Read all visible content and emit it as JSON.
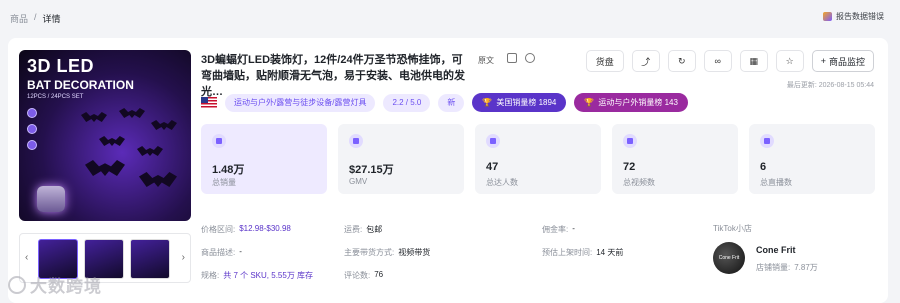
{
  "breadcrumb": {
    "parent": "商品",
    "sep": "/",
    "current": "详情"
  },
  "report_label": "报告数据错误",
  "product": {
    "title": "3D蝙蝠灯LED装饰灯，12件/24件万圣节恐怖挂饰，可弯曲墙贴，贴附顺滑无气泡，易于安装、电池供电的发光…",
    "original_label": "原文",
    "updated": "最后更新: 2026-08-15 05:44"
  },
  "hero_image": {
    "line1": "3D LED",
    "line2": "BAT DECORATION",
    "line3": "12PCS / 24PCS SET"
  },
  "actions": {
    "shelf": "货盘",
    "monitor": "商品监控"
  },
  "tags": {
    "category": "运动与户外/露营与徒步设备/露营灯具",
    "rating": "2.2 / 5.0",
    "new": "新",
    "us_rank": "美国销量榜 1894",
    "cat_rank": "运动与户外销量榜 143"
  },
  "stats": [
    {
      "value": "1.48万",
      "label": "总销量"
    },
    {
      "value": "$27.15万",
      "label": "GMV"
    },
    {
      "value": "47",
      "label": "总达人数"
    },
    {
      "value": "72",
      "label": "总视频数"
    },
    {
      "value": "6",
      "label": "总直播数"
    }
  ],
  "info": {
    "price_label": "价格区间:",
    "price_value": "$12.98-$30.98",
    "desc_label": "商品描述:",
    "desc_value": "-",
    "spec_label": "规格:",
    "spec_value": "共 7 个 SKU, 5.55万 库存",
    "ship_label": "运费:",
    "ship_value": "包邮",
    "type_label": "主要带货方式:",
    "type_value": "视频带货",
    "reviews_label": "评论数:",
    "reviews_value": "76",
    "commission_label": "佣金率:",
    "commission_value": "-",
    "listed_label": "预估上架时间:",
    "listed_value": "14 天前"
  },
  "shop": {
    "header": "TikTok小店",
    "avatar_text": "Cone Frit",
    "name": "Cone Frit",
    "sales_label": "店铺销量:",
    "sales_value": "7.87万"
  },
  "watermark": "大数跨境",
  "colors": {
    "accent": "#5a34c9",
    "rank_us": "#5a34c9",
    "rank_cat": "#9a2a9f",
    "tag_bg": "#ede9ff"
  }
}
